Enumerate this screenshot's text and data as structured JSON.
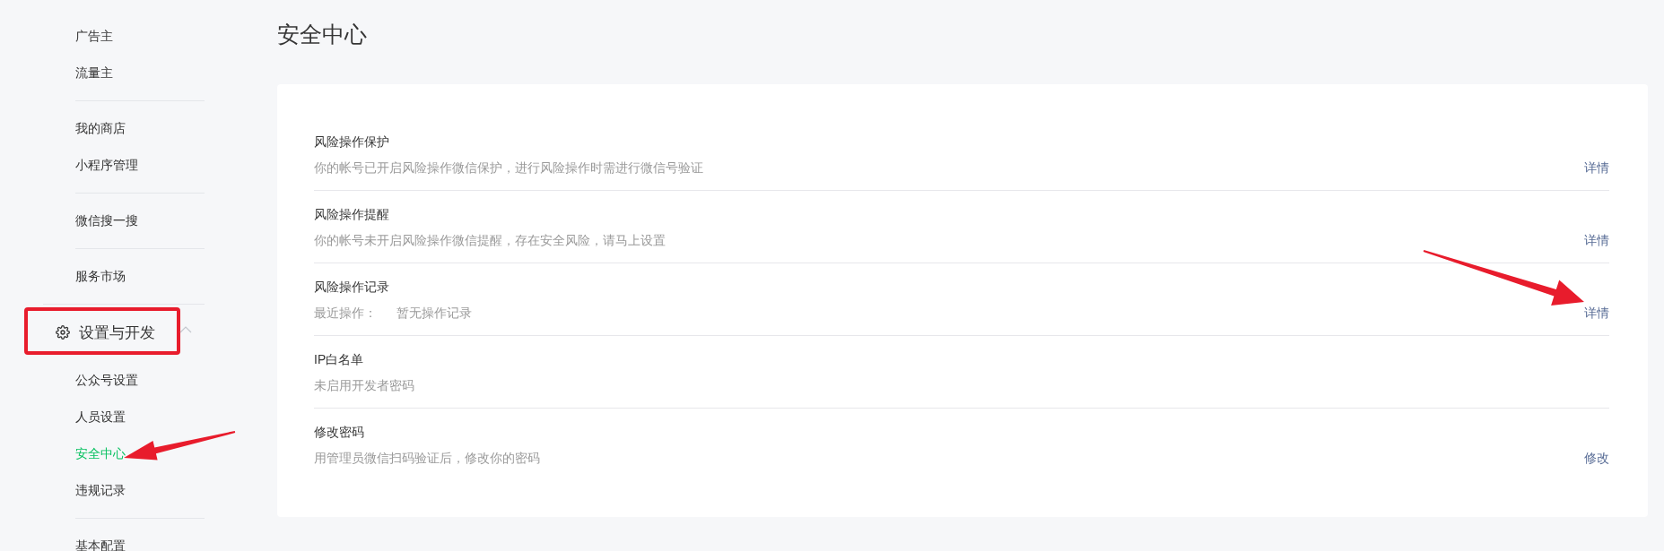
{
  "sidebar": {
    "groups": [
      {
        "items": [
          {
            "label": "广告主",
            "selected": false
          },
          {
            "label": "流量主",
            "selected": false
          }
        ]
      },
      {
        "items": [
          {
            "label": "我的商店",
            "selected": false
          },
          {
            "label": "小程序管理",
            "selected": false
          }
        ]
      },
      {
        "items": [
          {
            "label": "微信搜一搜",
            "selected": false
          }
        ]
      },
      {
        "items": [
          {
            "label": "服务市场",
            "selected": false
          }
        ]
      },
      {
        "header": {
          "label": "设置与开发",
          "expanded": true
        },
        "items": [
          {
            "label": "公众号设置",
            "selected": false
          },
          {
            "label": "人员设置",
            "selected": false
          },
          {
            "label": "安全中心",
            "selected": true
          },
          {
            "label": "违规记录",
            "selected": false
          }
        ]
      },
      {
        "items": [
          {
            "label": "基本配置",
            "selected": false
          }
        ]
      }
    ]
  },
  "page": {
    "title": "安全中心"
  },
  "settings": [
    {
      "title": "风险操作保护",
      "description": "你的帐号已开启风险操作微信保护，进行风险操作时需进行微信号验证",
      "action": "详情"
    },
    {
      "title": "风险操作提醒",
      "description": "你的帐号未开启风险操作微信提醒，存在安全风险，请马上设置",
      "action": "详情"
    },
    {
      "title": "风险操作记录",
      "description_label": "最近操作：",
      "description": "暂无操作记录",
      "action": "详情"
    },
    {
      "title": "IP白名单",
      "description": "未启用开发者密码"
    },
    {
      "title": "修改密码",
      "description": "用管理员微信扫码验证后，修改你的密码",
      "action": "修改"
    }
  ]
}
